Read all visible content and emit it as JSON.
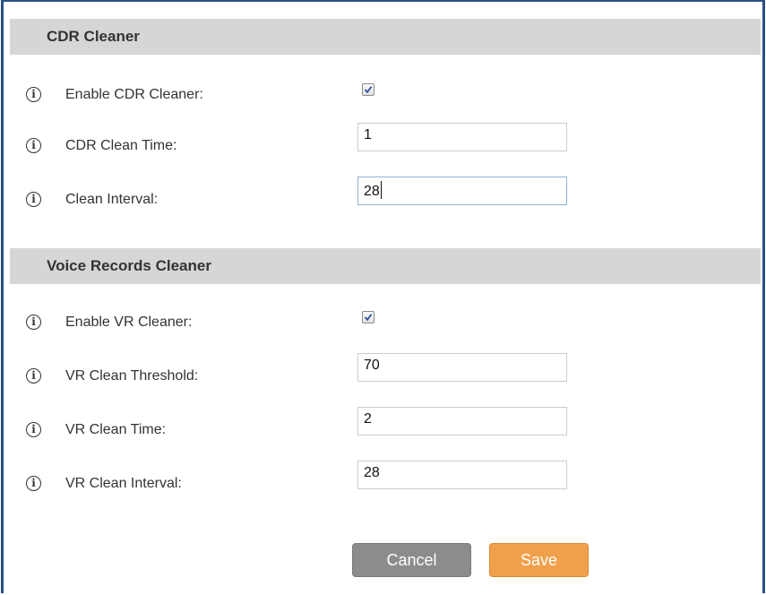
{
  "cdr_section": {
    "title": "CDR Cleaner",
    "enable_label": "Enable CDR Cleaner:",
    "enable_checked": true,
    "clean_time_label": "CDR Clean Time:",
    "clean_time_value": "1",
    "clean_interval_label": "Clean Interval:",
    "clean_interval_value": "28"
  },
  "vr_section": {
    "title": "Voice Records Cleaner",
    "enable_label": "Enable VR Cleaner:",
    "enable_checked": true,
    "threshold_label": "VR Clean Threshold:",
    "threshold_value": "70",
    "clean_time_label": "VR Clean Time:",
    "clean_time_value": "2",
    "clean_interval_label": "VR Clean Interval:",
    "clean_interval_value": "28"
  },
  "icons": {
    "info": "i"
  },
  "actions": {
    "cancel_label": "Cancel",
    "save_label": "Save"
  },
  "colors": {
    "frame_border": "#2a4f86",
    "header_bg": "#d6d6d6",
    "cancel_bg": "#8c8c8c",
    "save_bg": "#f0a04b"
  }
}
